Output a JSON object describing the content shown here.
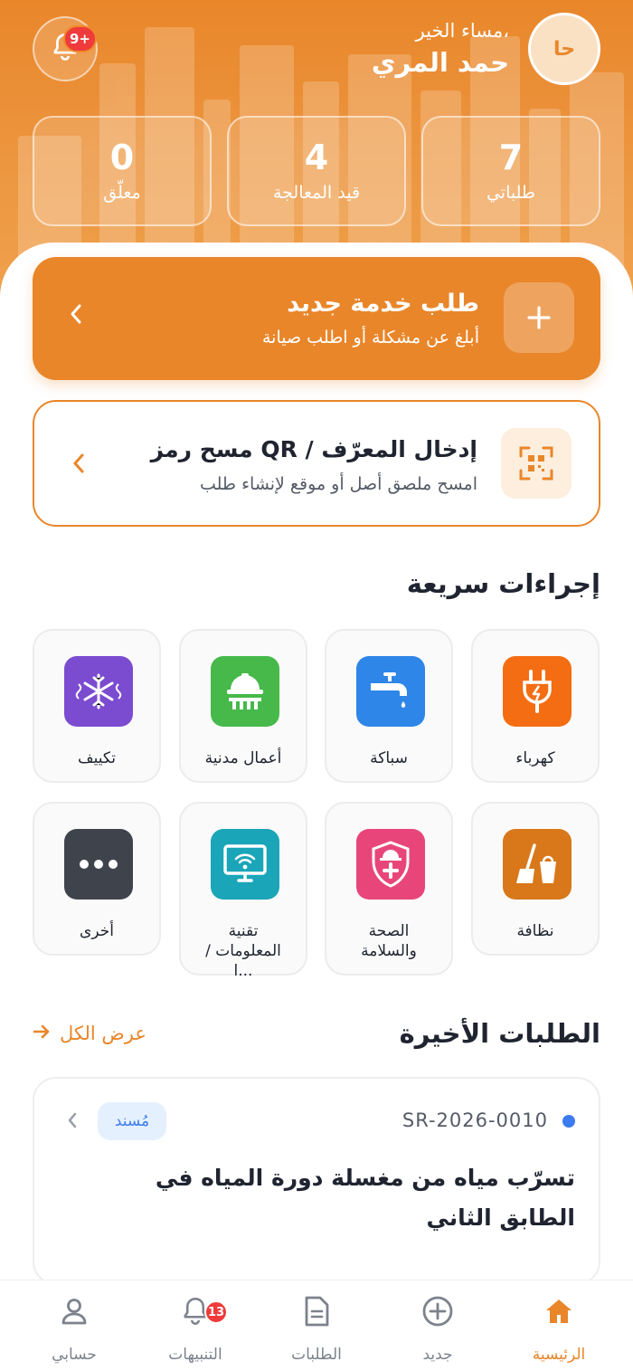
{
  "header": {
    "greeting": "مساء الخير،",
    "user_name": "حمد المري",
    "avatar_initials": "حا",
    "notification_badge": "9+"
  },
  "stats": [
    {
      "value": "7",
      "label": "طلباتي"
    },
    {
      "value": "4",
      "label": "قيد المعالجة"
    },
    {
      "value": "0",
      "label": "معلّق"
    }
  ],
  "new_request": {
    "title": "طلب خدمة جديد",
    "subtitle": "أبلغ عن مشكلة أو اطلب صيانة"
  },
  "qr_scan": {
    "title": "مسح رمز QR / إدخال المعرّف",
    "subtitle": "امسح ملصق أصل أو موقع لإنشاء طلب"
  },
  "quick_actions": {
    "title": "إجراءات سريعة",
    "items": [
      {
        "label": "كهرباء",
        "icon": "plug-icon",
        "color": "#f46d12"
      },
      {
        "label": "سباكة",
        "icon": "faucet-icon",
        "color": "#2e86e8"
      },
      {
        "label": "أعمال مدنية",
        "icon": "helmet-icon",
        "color": "#46b94a"
      },
      {
        "label": "تكييف",
        "icon": "snowflake-icon",
        "color": "#7b4bd0"
      },
      {
        "label": "نظافة",
        "icon": "broom-icon",
        "color": "#d8781a"
      },
      {
        "label": "الصحة والسلامة",
        "icon": "shield-icon",
        "color": "#e8467a"
      },
      {
        "label": "تقنية المعلومات / ا...",
        "icon": "monitor-wifi-icon",
        "color": "#1aa5b8"
      },
      {
        "label": "أخرى",
        "icon": "more-icon",
        "color": "#3f444c"
      }
    ]
  },
  "recent": {
    "title": "الطلبات الأخيرة",
    "view_all": "عرض الكل",
    "items": [
      {
        "code": "SR-2026-0010",
        "status": "مُسند",
        "title": "تسرّب مياه من مغسلة دورة المياه في الطابق الثاني"
      }
    ]
  },
  "bottom_nav": {
    "items": [
      {
        "label": "الرئيسية",
        "icon": "home-icon",
        "active": true
      },
      {
        "label": "جديد",
        "icon": "plus-circle-icon"
      },
      {
        "label": "الطلبات",
        "icon": "document-icon"
      },
      {
        "label": "التنبيهات",
        "icon": "bell-icon",
        "badge": "13"
      },
      {
        "label": "حسابي",
        "icon": "user-icon"
      }
    ]
  },
  "colors": {
    "primary": "#e9862a",
    "status_blue": "#3d7bf0",
    "badge_red": "#ef3b3b"
  }
}
